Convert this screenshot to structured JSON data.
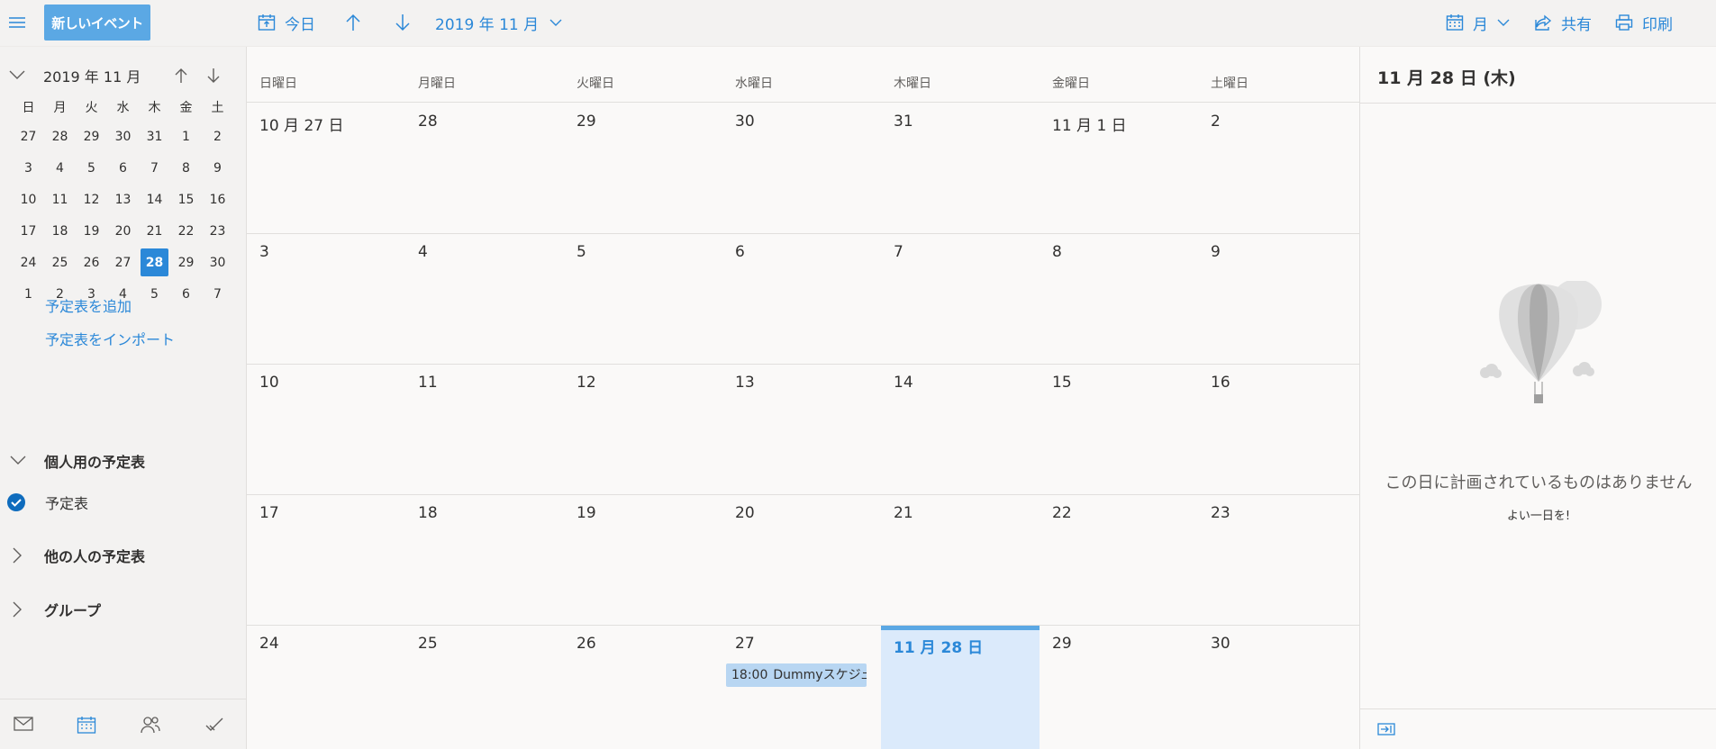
{
  "toolbar": {
    "new_event": "新しいイベント",
    "today": "今日",
    "month_label": "2019 年 11 月",
    "view_label": "月",
    "share": "共有",
    "print": "印刷"
  },
  "sidebar": {
    "mini_title": "2019 年 11 月",
    "weekdays": [
      "日",
      "月",
      "火",
      "水",
      "木",
      "金",
      "土"
    ],
    "weeks": [
      [
        "27",
        "28",
        "29",
        "30",
        "31",
        "1",
        "2"
      ],
      [
        "3",
        "4",
        "5",
        "6",
        "7",
        "8",
        "9"
      ],
      [
        "10",
        "11",
        "12",
        "13",
        "14",
        "15",
        "16"
      ],
      [
        "17",
        "18",
        "19",
        "20",
        "21",
        "22",
        "23"
      ],
      [
        "24",
        "25",
        "26",
        "27",
        "28",
        "29",
        "30"
      ],
      [
        "1",
        "2",
        "3",
        "4",
        "5",
        "6",
        "7"
      ]
    ],
    "today": "28",
    "add_calendar": "予定表を追加",
    "import_calendar": "予定表をインポート",
    "personal_calendars": "個人用の予定表",
    "calendar_item": "予定表",
    "others_calendars": "他の人の予定表",
    "groups": "グループ"
  },
  "month": {
    "weekdays": [
      "日曜日",
      "月曜日",
      "火曜日",
      "水曜日",
      "木曜日",
      "金曜日",
      "土曜日"
    ],
    "weeks": [
      [
        "10 月 27 日",
        "28",
        "29",
        "30",
        "31",
        "11 月 1 日",
        "2"
      ],
      [
        "3",
        "4",
        "5",
        "6",
        "7",
        "8",
        "9"
      ],
      [
        "10",
        "11",
        "12",
        "13",
        "14",
        "15",
        "16"
      ],
      [
        "17",
        "18",
        "19",
        "20",
        "21",
        "22",
        "23"
      ],
      [
        "24",
        "25",
        "26",
        "27",
        "11 月 28 日",
        "29",
        "30"
      ]
    ],
    "event": {
      "time": "18:00",
      "title": "Dummyスケジュール"
    }
  },
  "detail": {
    "title": "11 月 28 日 (木)",
    "empty": "この日に計画されているものはありません",
    "sub": "よい一日を!"
  },
  "colors": {
    "accent": "#2b88d8",
    "button": "#5ba8e4",
    "selected_day": "#dbeafb",
    "event": "#b8d6f2"
  }
}
